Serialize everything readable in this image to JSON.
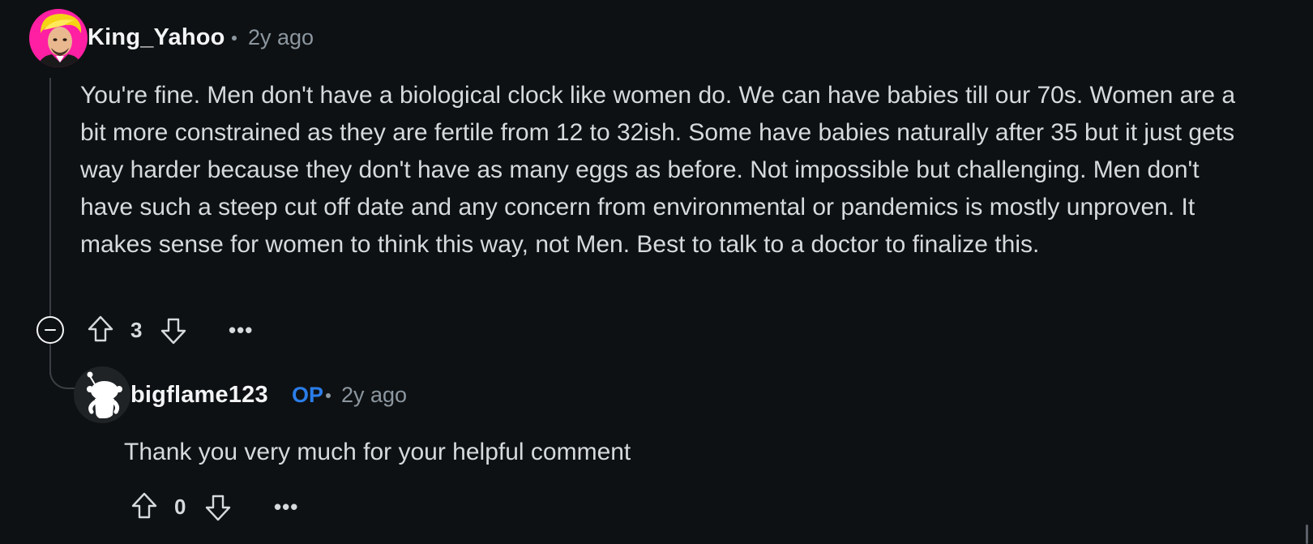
{
  "comments": [
    {
      "username": "King_Yahoo",
      "age": "2y ago",
      "body": "You're fine. Men don't have a biological clock like women do. We can have babies till our 70s. Women are a bit more constrained as they are fertile from 12 to 32ish. Some have babies naturally after 35 but it just gets way harder because they don't have as many eggs as before. Not impossible but challenging. Men don't have such a steep cut off date and any concern from environmental or pandemics is mostly unproven. It makes sense for women to think this way, not Men. Best to talk to a doctor to finalize this.",
      "score": "3",
      "avatar_icon": "cartoon-avatar-icon",
      "colors": {
        "avatar_bg": "#ff1fa3",
        "hair": "#f5d315"
      }
    },
    {
      "username": "bigflame123",
      "op_label": "OP",
      "age": "2y ago",
      "body": "Thank you very much for your helpful comment",
      "score": "0",
      "avatar_icon": "snoo-avatar-icon",
      "colors": {
        "avatar_bg": "#1f2326",
        "op": "#2b7de9"
      }
    }
  ],
  "icons": {
    "upvote": "upvote-arrow-icon",
    "downvote": "downvote-arrow-icon",
    "more": "more-options-icon",
    "collapse": "collapse-thread-icon"
  },
  "more_label": "•••"
}
